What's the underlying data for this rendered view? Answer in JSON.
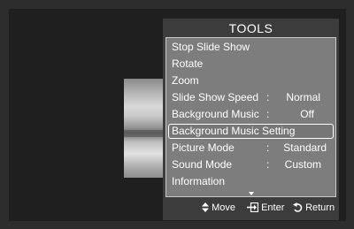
{
  "tools_menu": {
    "title": "TOOLS",
    "items": [
      {
        "label": "Stop Slide Show",
        "sep": "",
        "value": ""
      },
      {
        "label": "Rotate",
        "sep": "",
        "value": ""
      },
      {
        "label": "Zoom",
        "sep": "",
        "value": ""
      },
      {
        "label": "Slide Show Speed",
        "sep": ":",
        "value": "Normal"
      },
      {
        "label": "Background Music",
        "sep": ":",
        "value": "Off"
      },
      {
        "label": "Background Music Setting",
        "sep": "",
        "value": ""
      },
      {
        "label": "Picture Mode",
        "sep": ":",
        "value": "Standard"
      },
      {
        "label": "Sound Mode",
        "sep": ":",
        "value": "Custom"
      },
      {
        "label": "Information",
        "sep": "",
        "value": ""
      }
    ],
    "selected_index": 5
  },
  "hints": {
    "move": {
      "icon": "updown-arrows-icon",
      "label": "Move"
    },
    "enter": {
      "icon": "enter-icon",
      "label": "Enter"
    },
    "return": {
      "icon": "return-icon",
      "label": "Return"
    }
  },
  "colors": {
    "panel": "#7d7d7d",
    "frame": "#3c3c3c",
    "background": "#1f1f1f"
  }
}
